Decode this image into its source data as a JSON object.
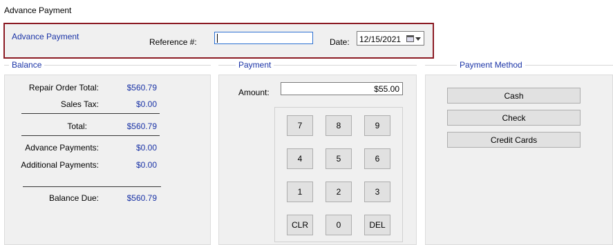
{
  "window": {
    "title": "Advance Payment"
  },
  "header": {
    "group_label": "Advance Payment",
    "reference_label": "Reference #:",
    "reference_value": "",
    "date_label": "Date:",
    "date_value": "12/15/2021"
  },
  "balance": {
    "heading": "Balance",
    "rows": [
      {
        "label": "Repair Order Total:",
        "value": "$560.79"
      },
      {
        "label": "Sales Tax:",
        "value": "$0.00"
      },
      {
        "label": "Total:",
        "value": "$560.79"
      },
      {
        "label": "Advance Payments:",
        "value": "$0.00"
      },
      {
        "label": "Additional Payments:",
        "value": "$0.00"
      },
      {
        "label": "Balance Due:",
        "value": "$560.79"
      }
    ]
  },
  "payment": {
    "heading": "Payment",
    "amount_label": "Amount:",
    "amount_value": "$55.00",
    "keys": [
      "7",
      "8",
      "9",
      "4",
      "5",
      "6",
      "1",
      "2",
      "3",
      "CLR",
      "0",
      "DEL"
    ]
  },
  "payment_method": {
    "heading": "Payment Method",
    "buttons": [
      "Cash",
      "Check",
      "Credit Cards"
    ]
  },
  "colors": {
    "accent_text": "#1a33a6",
    "highlight_border": "#8b1a23"
  }
}
